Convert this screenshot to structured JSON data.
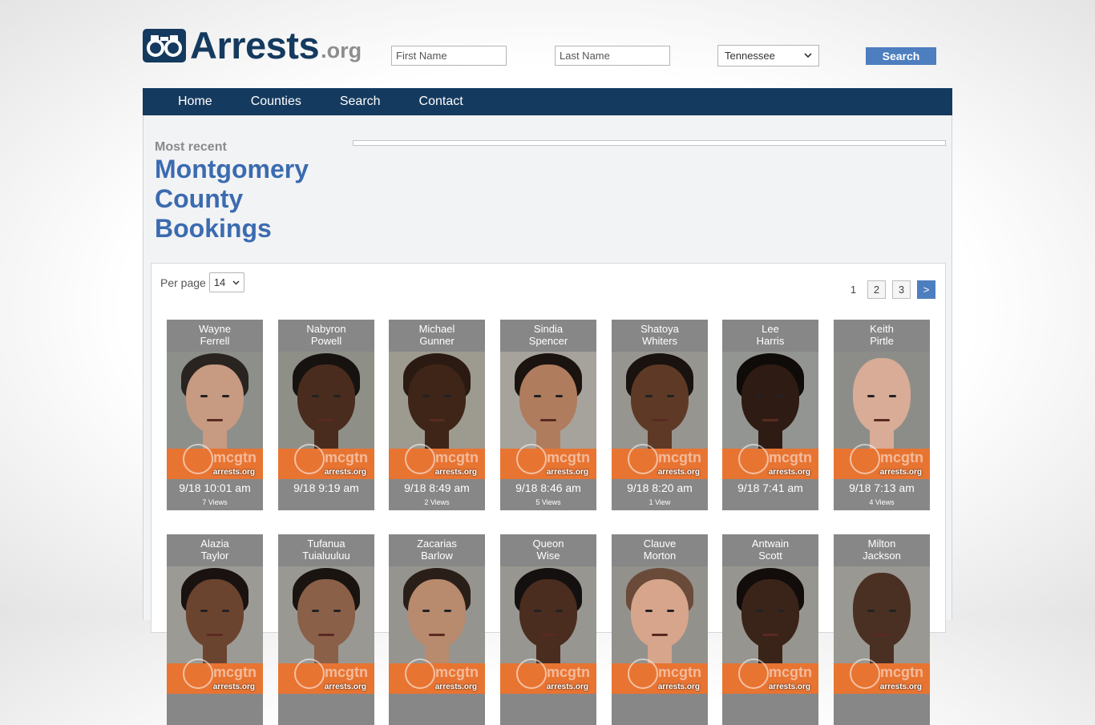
{
  "site": {
    "logo_text": "Arrests",
    "logo_suffix": ".org"
  },
  "search": {
    "first_placeholder": "First Name",
    "last_placeholder": "Last Name",
    "state_value": "Tennessee",
    "button_label": "Search"
  },
  "nav": [
    "Home",
    "Counties",
    "Search",
    "Contact"
  ],
  "page": {
    "eyebrow": "Most recent",
    "title_line1": "Montgomery",
    "title_line2": "County",
    "title_line3": "Bookings"
  },
  "controls": {
    "per_page_label": "Per page",
    "per_page_value": "14",
    "pages": [
      "1",
      "2",
      "3"
    ],
    "next_label": ">"
  },
  "watermark": {
    "circle_text": "mcgtn",
    "site_text": "arrests.org"
  },
  "inmates_row1": [
    {
      "first": "Wayne",
      "last": "Ferrell",
      "time": "9/18 10:01 am",
      "views": "7 Views",
      "skin": "#c79a82",
      "hair": "#2a2420",
      "bg": "#8d8f8a"
    },
    {
      "first": "Nabyron",
      "last": "Powell",
      "time": "9/18 9:19 am",
      "views": "",
      "skin": "#4a2c1e",
      "hair": "#161210",
      "bg": "#8e9088"
    },
    {
      "first": "Michael",
      "last": "Gunner",
      "time": "9/18 8:49 am",
      "views": "2 Views",
      "skin": "#3e2518",
      "hair": "#2a1a12",
      "bg": "#9d9a90"
    },
    {
      "first": "Sindia",
      "last": "Spencer",
      "time": "9/18 8:46 am",
      "views": "5 Views",
      "skin": "#b07c5e",
      "hair": "#1a130f",
      "bg": "#a6a39c"
    },
    {
      "first": "Shatoya",
      "last": "Whiters",
      "time": "9/18 8:20 am",
      "views": "1 View",
      "skin": "#5e3a26",
      "hair": "#19120e",
      "bg": "#979590"
    },
    {
      "first": "Lee",
      "last": "Harris",
      "time": "9/18 7:41 am",
      "views": "",
      "skin": "#2e1c14",
      "hair": "#0f0b09",
      "bg": "#939592"
    },
    {
      "first": "Keith",
      "last": "Pirtle",
      "time": "9/18 7:13 am",
      "views": "4 Views",
      "skin": "#d8ac96",
      "hair": "#d8ac96",
      "bg": "#8c8d88"
    }
  ],
  "inmates_row2": [
    {
      "first": "Alazia",
      "last": "Taylor",
      "skin": "#6b4430",
      "hair": "#1a1210",
      "bg": "#9c9a95"
    },
    {
      "first": "Tufanua",
      "last": "Tuialuuluu",
      "skin": "#8a6048",
      "hair": "#1a1410",
      "bg": "#9a9893"
    },
    {
      "first": "Zacarias",
      "last": "Barlow",
      "skin": "#b88a6e",
      "hair": "#2a1f18",
      "bg": "#96948f"
    },
    {
      "first": "Queon",
      "last": "Wise",
      "skin": "#4a2d1f",
      "hair": "#151010",
      "bg": "#989690"
    },
    {
      "first": "Clauve",
      "last": "Morton",
      "skin": "#d6a58c",
      "hair": "#6a4a38",
      "bg": "#93918c"
    },
    {
      "first": "Antwain",
      "last": "Scott",
      "skin": "#3a2419",
      "hair": "#120d0b",
      "bg": "#97958f"
    },
    {
      "first": "Milton",
      "last": "Jackson",
      "skin": "#4a3023",
      "hair": "#4a3023",
      "bg": "#9a9892"
    }
  ]
}
